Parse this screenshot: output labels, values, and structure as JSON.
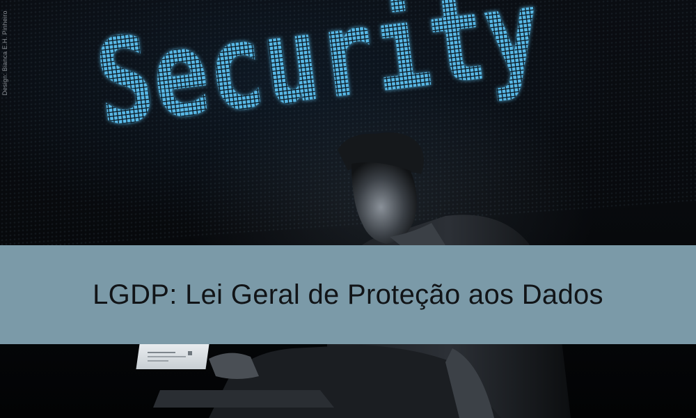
{
  "image": {
    "screen_word": "Security",
    "credit": "Design: Bianca E.H. Pinheiro",
    "title": "LGDP: Lei Geral de Proteção aos Dados"
  },
  "colors": {
    "banner": "#7b9aa8",
    "title_text": "#111417",
    "led_glow": "#3fa6d8",
    "background": "#050608"
  }
}
